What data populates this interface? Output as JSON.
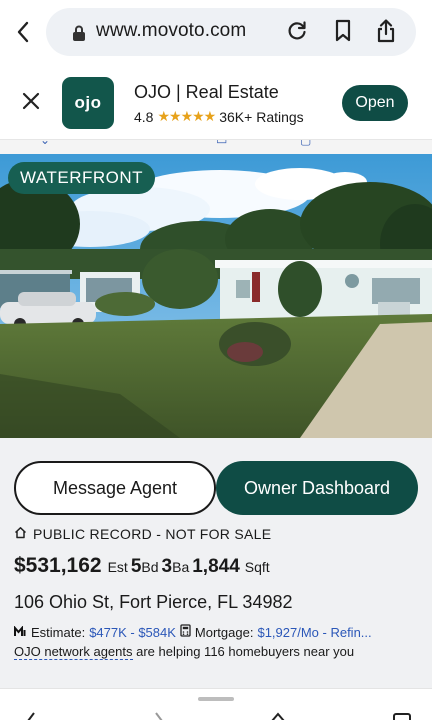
{
  "browser": {
    "url": "www.movoto.com"
  },
  "app_banner": {
    "icon_text": "ojo",
    "name": "OJO | Real Estate",
    "rating": "4.8",
    "stars": "★★★★★",
    "ratings_count": "36K+ Ratings",
    "open_label": "Open"
  },
  "photo": {
    "badge": "WATERFRONT"
  },
  "actions": {
    "message_agent": "Message Agent",
    "owner_dashboard": "Owner Dashboard"
  },
  "listing": {
    "status": "PUBLIC RECORD - NOT FOR SALE",
    "price": "$531,162",
    "price_unit": "Est",
    "beds": "5",
    "beds_unit": "Bd",
    "baths": "3",
    "baths_unit": "Ba",
    "sqft": "1,844",
    "sqft_unit": "Sqft",
    "address": "106 Ohio St, Fort Pierce, FL 34982",
    "estimate_label": "Estimate:",
    "estimate_range": "$477K - $584K",
    "mortgage_label": "Mortgage:",
    "mortgage_value": "$1,927/Mo - Refin...",
    "network_link": "OJO network agents",
    "network_text": " are helping 116 homebuyers near you"
  },
  "colors": {
    "brand_green": "#0f4c45",
    "link_blue": "#2b57b8",
    "star_gold": "#e7a21b"
  }
}
